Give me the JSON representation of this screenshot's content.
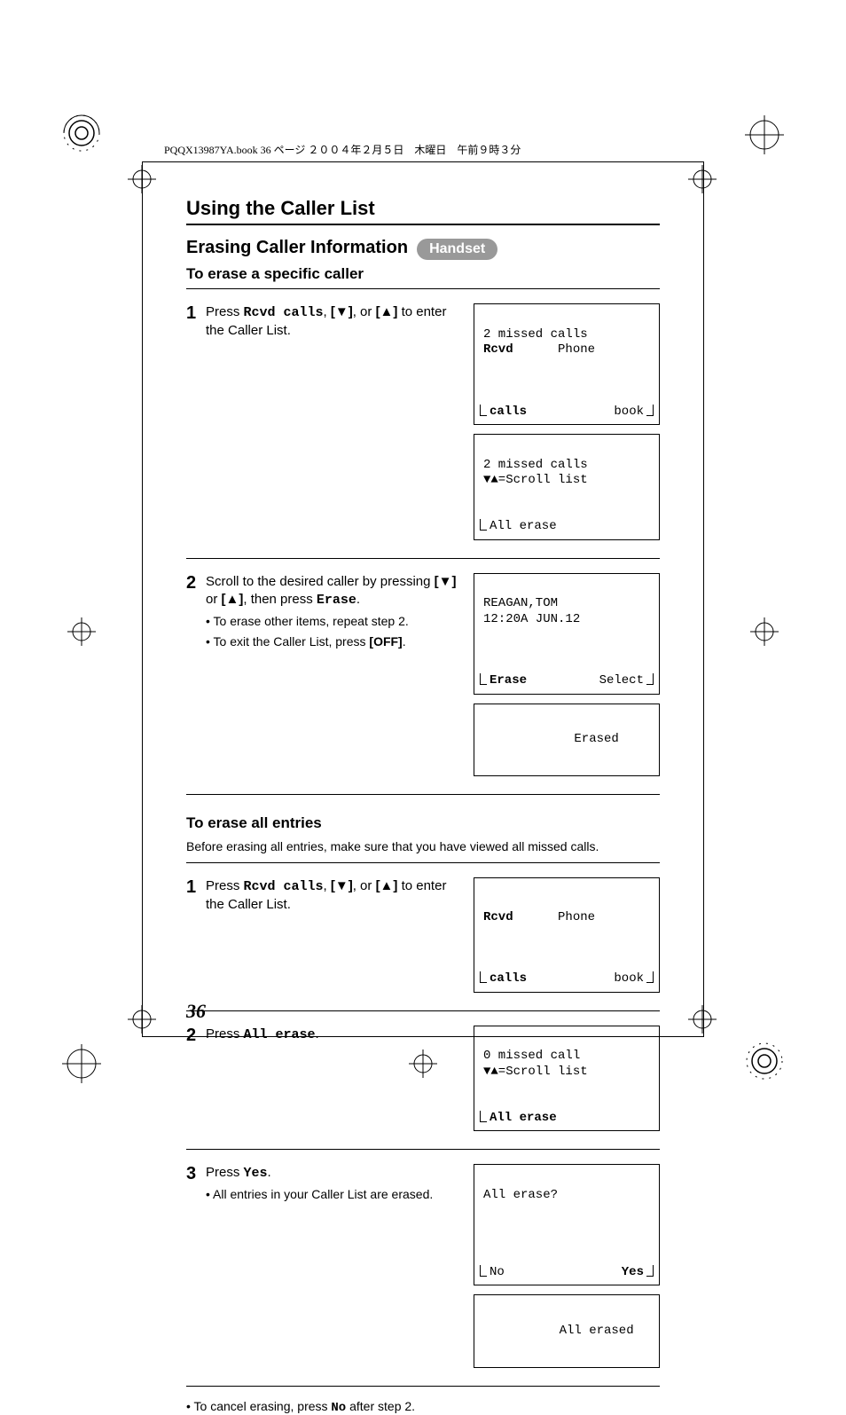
{
  "header_line": "PQQX13987YA.book  36 ページ  ２００４年２月５日　木曜日　午前９時３分",
  "section_title": "Using the Caller List",
  "erasing_heading": "Erasing Caller Information",
  "handset_pill": "Handset",
  "specific": {
    "heading": "To erase a specific caller",
    "step1": {
      "num": "1",
      "press": "Press ",
      "cmd": "Rcvd calls",
      "mid": ", ",
      "key1": "[▼]",
      "or": ", or ",
      "key2": "[▲]",
      "tail": " to enter the Caller List.",
      "screen1": {
        "line1": "2 missed calls",
        "left_label": "Rcvd",
        "right_label": "Phone",
        "soft_left": "calls",
        "soft_right": "book"
      },
      "screen2": {
        "line1": "2 missed calls",
        "line2": "▼▲=Scroll list",
        "soft_left": "All erase"
      }
    },
    "step2": {
      "num": "2",
      "t1": "Scroll to the desired caller by pressing ",
      "key1": "[▼]",
      "t2": " or ",
      "key2": "[▲]",
      "t3": ", then press ",
      "cmd": "Erase",
      "t4": ".",
      "bullet1": "To erase other items, repeat step 2.",
      "bullet2_a": "To exit the Caller List, press ",
      "bullet2_b": "[OFF]",
      "bullet2_c": ".",
      "screen1": {
        "line1": "REAGAN,TOM",
        "line2": "12:20A JUN.12",
        "soft_left": "Erase",
        "soft_right": "Select"
      },
      "screen2": {
        "line1": "Erased"
      }
    }
  },
  "all": {
    "heading": "To erase all entries",
    "intro": "Before erasing all entries, make sure that you have viewed all missed calls.",
    "step1": {
      "num": "1",
      "press": "Press ",
      "cmd": "Rcvd calls",
      "mid": ", ",
      "key1": "[▼]",
      "or": ", or ",
      "key2": "[▲]",
      "tail": " to enter the Caller List.",
      "screen": {
        "left_label": "Rcvd",
        "right_label": "Phone",
        "soft_left": "calls",
        "soft_right": "book"
      }
    },
    "step2": {
      "num": "2",
      "press": "Press ",
      "cmd": "All erase",
      "tail": ".",
      "screen": {
        "line1": "0 missed call",
        "line2": "▼▲=Scroll list",
        "soft_left": "All erase"
      }
    },
    "step3": {
      "num": "3",
      "press": "Press ",
      "cmd": "Yes",
      "tail": ".",
      "bullet": "All entries in your Caller List are erased.",
      "screen1": {
        "line1": "All erase?",
        "soft_left": "No",
        "soft_right": "Yes"
      },
      "screen2": {
        "line1": "All erased"
      }
    },
    "footnote_a": "To cancel erasing, press ",
    "footnote_cmd": "No",
    "footnote_b": " after step 2."
  },
  "page_number": "36"
}
